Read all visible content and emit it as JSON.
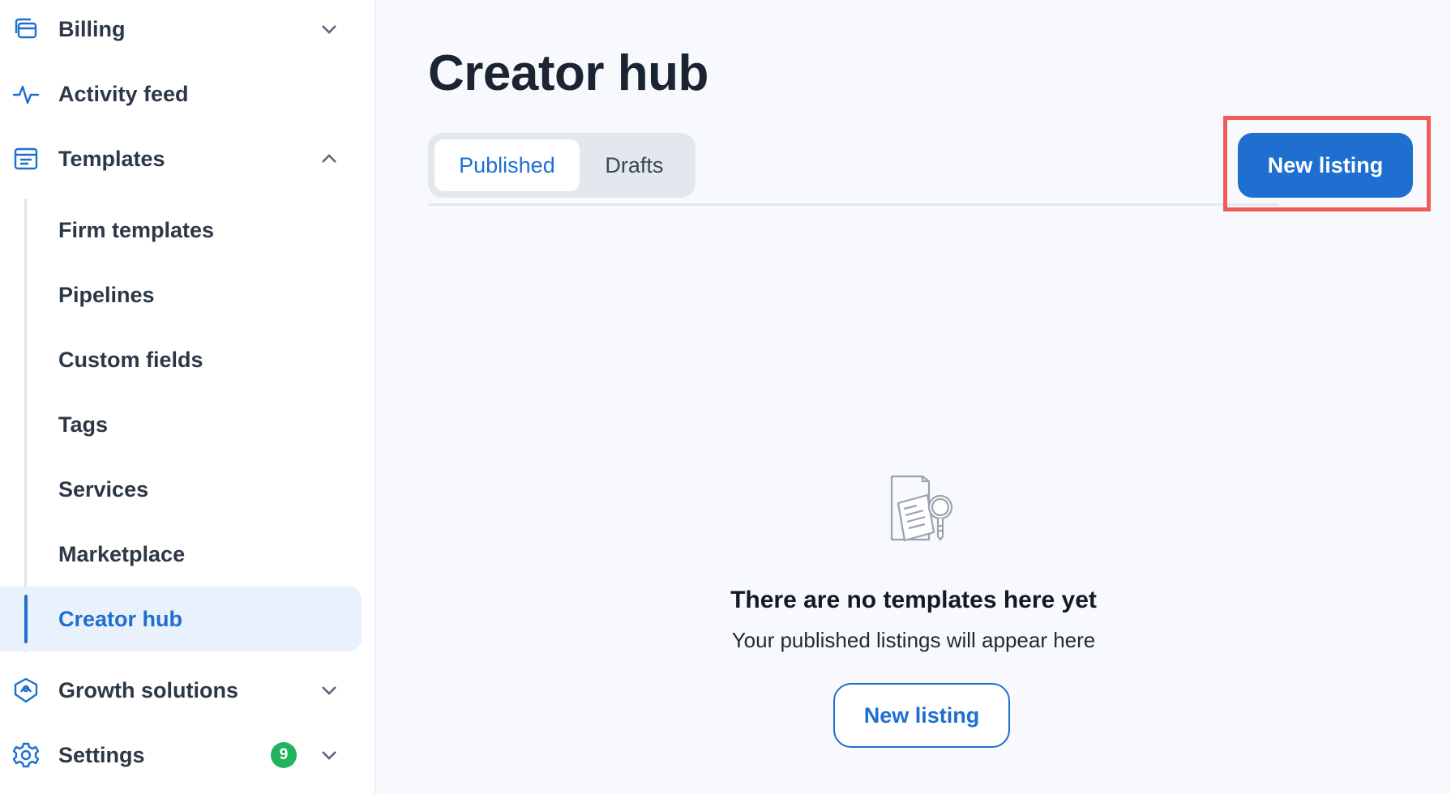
{
  "sidebar": {
    "items": [
      {
        "label": "Billing",
        "icon": "billing-icon"
      },
      {
        "label": "Activity feed",
        "icon": "activity-icon"
      },
      {
        "label": "Templates",
        "icon": "templates-icon"
      },
      {
        "label": "Growth solutions",
        "icon": "growth-icon"
      },
      {
        "label": "Settings",
        "icon": "settings-icon",
        "badge": "9"
      }
    ],
    "templates_sub": [
      "Firm templates",
      "Pipelines",
      "Custom fields",
      "Tags",
      "Services",
      "Marketplace",
      "Creator hub"
    ]
  },
  "main": {
    "title": "Creator hub",
    "tabs": [
      "Published",
      "Drafts"
    ],
    "new_listing_label": "New listing",
    "empty": {
      "title": "There are no templates here yet",
      "subtitle": "Your published listings will appear here",
      "button_label": "New listing"
    }
  },
  "colors": {
    "accent": "#1e6fcf",
    "badge": "#22b45c",
    "highlight": "#f05c5c"
  }
}
